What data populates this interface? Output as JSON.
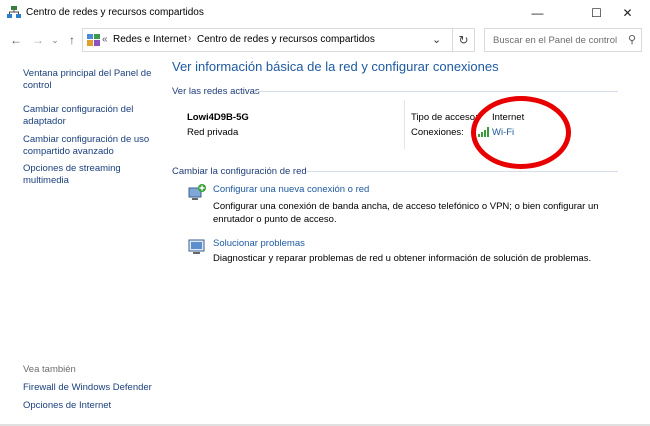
{
  "window": {
    "title": "Centro de redes y recursos compartidos",
    "controls": {
      "minimize": "—",
      "maximize": "☐",
      "close": "✕"
    }
  },
  "nav": {
    "back": "←",
    "forward": "→",
    "dropdown": "⌄",
    "up": "↑"
  },
  "address": {
    "separator": "«",
    "crumbs": [
      "Redes e Internet",
      "Centro de redes y recursos compartidos"
    ],
    "chevron": "›",
    "dropdown": "⌄",
    "refresh": "↻"
  },
  "search": {
    "placeholder": "Buscar en el Panel de control",
    "icon": "⚲"
  },
  "sidebar": {
    "links": [
      "Ventana principal del Panel de control",
      "Cambiar configuración del adaptador",
      "Cambiar configuración de uso compartido avanzado",
      "Opciones de streaming multimedia"
    ],
    "see_also_title": "Vea también",
    "see_also": [
      "Firewall de Windows Defender",
      "Opciones de Internet"
    ]
  },
  "main": {
    "title": "Ver información básica de la red y configurar conexiones",
    "active_networks_title": "Ver las redes activas",
    "network": {
      "name": "Lowi4D9B-5G",
      "type": "Red privada",
      "access_label": "Tipo de acceso:",
      "access_value": "Internet",
      "connections_label": "Conexiones:",
      "connection_value": "Wi-Fi"
    },
    "change_title": "Cambiar la configuración de red",
    "tasks": [
      {
        "icon": "new-connection-icon",
        "link": "Configurar una nueva conexión o red",
        "description": "Configurar una conexión de banda ancha, de acceso telefónico o VPN; o bien configurar un enrutador o punto de acceso."
      },
      {
        "icon": "troubleshoot-icon",
        "link": "Solucionar problemas",
        "description": "Diagnosticar y reparar problemas de red u obtener información de solución de problemas."
      }
    ]
  },
  "colors": {
    "link": "#1e5aa0",
    "sidebar_link": "#1a3f7c",
    "annotation": "#e80000",
    "wifi": "#3a9a3a"
  }
}
